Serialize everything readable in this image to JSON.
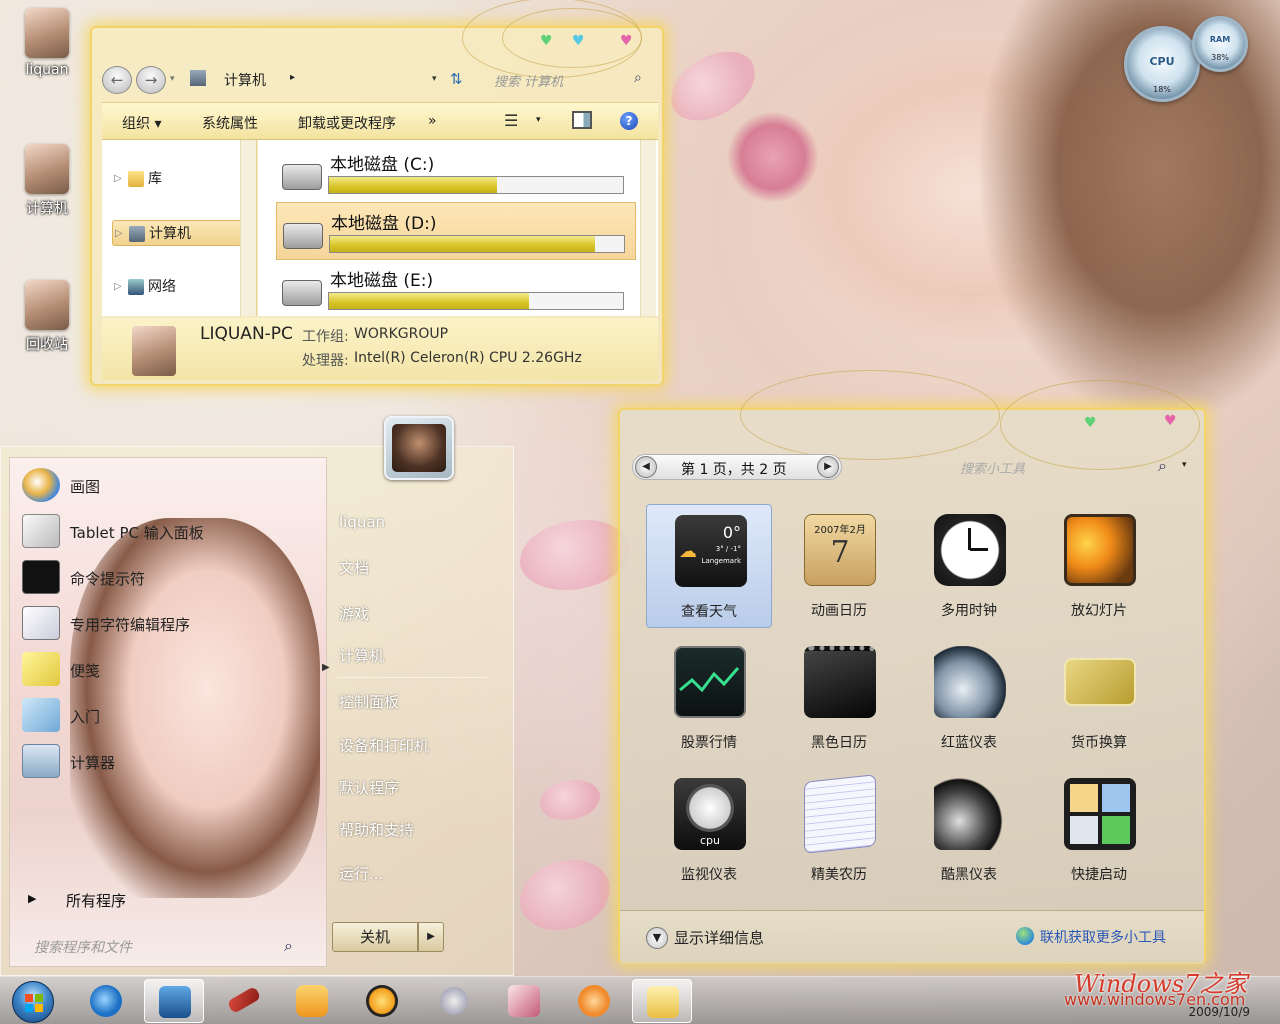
{
  "desktop": {
    "icons": [
      {
        "label": "liquan"
      },
      {
        "label": "计算机"
      },
      {
        "label": "回收站"
      }
    ]
  },
  "cpu_gadget": {
    "cpu_label": "CPU",
    "cpu_value": "18%",
    "ram_label": "RAM",
    "ram_value": "38%"
  },
  "explorer": {
    "breadcrumb": "计算机",
    "search_placeholder": "搜索 计算机",
    "toolbar": {
      "organize": "组织 ▾",
      "system_properties": "系统属性",
      "uninstall": "卸载或更改程序",
      "more": "»"
    },
    "tree": [
      {
        "label": "库"
      },
      {
        "label": "计算机"
      },
      {
        "label": "网络"
      }
    ],
    "drives": [
      {
        "name": "本地磁盘 (C:)",
        "used_fraction": 0.57
      },
      {
        "name": "本地磁盘 (D:)",
        "used_fraction": 0.9
      },
      {
        "name": "本地磁盘 (E:)",
        "used_fraction": 0.68
      }
    ],
    "details": {
      "pc_name": "LIQUAN-PC",
      "workgroup_label": "工作组:",
      "workgroup_value": "WORKGROUP",
      "cpu_label": "处理器:",
      "cpu_value": "Intel(R) Celeron(R) CPU 2.26GHz"
    }
  },
  "start_menu": {
    "programs": [
      {
        "label": "画图"
      },
      {
        "label": "Tablet PC 输入面板"
      },
      {
        "label": "命令提示符"
      },
      {
        "label": "专用字符编辑程序"
      },
      {
        "label": "便笺"
      },
      {
        "label": "入门"
      },
      {
        "label": "计算器"
      }
    ],
    "all_programs": "所有程序",
    "search_placeholder": "搜索程序和文件",
    "right": [
      {
        "label": "liquan"
      },
      {
        "label": "文档"
      },
      {
        "label": "游戏"
      },
      {
        "label": "计算机"
      },
      {
        "label": "控制面板"
      },
      {
        "label": "设备和打印机"
      },
      {
        "label": "默认程序"
      },
      {
        "label": "帮助和支持"
      },
      {
        "label": "运行..."
      }
    ],
    "shutdown": "关机"
  },
  "gadgets": {
    "pager": "第 1 页，共 2 页",
    "search_placeholder": "搜索小工具",
    "items": [
      {
        "label": "查看天气",
        "icon": "weather-icon"
      },
      {
        "label": "动画日历",
        "icon": "calendar-icon"
      },
      {
        "label": "多用时钟",
        "icon": "clock-icon"
      },
      {
        "label": "放幻灯片",
        "icon": "slideshow-icon"
      },
      {
        "label": "股票行情",
        "icon": "stocks-icon"
      },
      {
        "label": "黑色日历",
        "icon": "black-calendar-icon"
      },
      {
        "label": "红蓝仪表",
        "icon": "red-blue-meter-icon"
      },
      {
        "label": "货币换算",
        "icon": "currency-icon"
      },
      {
        "label": "监视仪表",
        "icon": "cpu-meter-icon"
      },
      {
        "label": "精美农历",
        "icon": "lunar-calendar-icon"
      },
      {
        "label": "酷黑仪表",
        "icon": "black-meter-icon"
      },
      {
        "label": "快捷启动",
        "icon": "quick-launch-icon"
      }
    ],
    "weather_temp": "0°",
    "weather_sub": "3° / -1°",
    "weather_city": "Langemark",
    "calendar_month": "2007年2月",
    "calendar_day": "7",
    "cpu_meter_label": "cpu",
    "show_details": "显示详细信息",
    "get_more": "联机获取更多小工具"
  },
  "taskbar": {
    "clock_date": "2009/10/9"
  },
  "watermark": {
    "brand": "Windows7之家",
    "url": "www.windows7en.com"
  }
}
